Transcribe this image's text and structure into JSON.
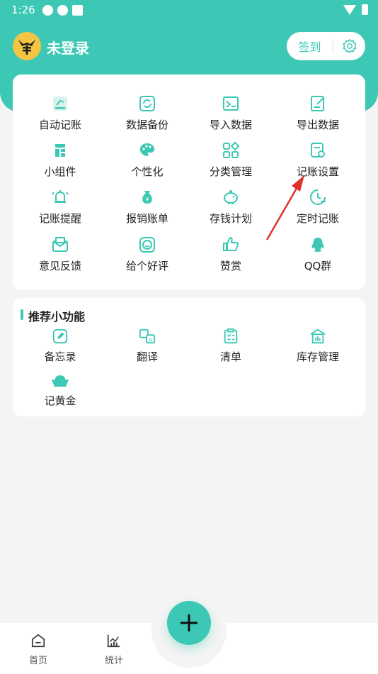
{
  "status_bar": {
    "time": "1:26"
  },
  "header": {
    "username": "未登录",
    "signin_label": "签到"
  },
  "tools": [
    {
      "label": "自动记账",
      "icon": "auto-bookkeeping-icon"
    },
    {
      "label": "数据备份",
      "icon": "data-backup-icon"
    },
    {
      "label": "导入数据",
      "icon": "import-data-icon"
    },
    {
      "label": "导出数据",
      "icon": "export-data-icon"
    },
    {
      "label": "小组件",
      "icon": "widget-icon"
    },
    {
      "label": "个性化",
      "icon": "palette-icon"
    },
    {
      "label": "分类管理",
      "icon": "category-icon"
    },
    {
      "label": "记账设置",
      "icon": "settings-doc-icon"
    },
    {
      "label": "记账提醒",
      "icon": "bell-icon"
    },
    {
      "label": "报销账单",
      "icon": "money-bag-icon"
    },
    {
      "label": "存钱计划",
      "icon": "piggy-bank-icon"
    },
    {
      "label": "定时记账",
      "icon": "clock-icon"
    },
    {
      "label": "意见反馈",
      "icon": "feedback-icon"
    },
    {
      "label": "给个好评",
      "icon": "rate-icon"
    },
    {
      "label": "赞赏",
      "icon": "thumbs-up-icon"
    },
    {
      "label": "QQ群",
      "icon": "qq-icon"
    }
  ],
  "recommended": {
    "title": "推荐小功能",
    "items": [
      {
        "label": "备忘录",
        "icon": "memo-icon"
      },
      {
        "label": "翻译",
        "icon": "translate-icon"
      },
      {
        "label": "清单",
        "icon": "checklist-icon"
      },
      {
        "label": "库存管理",
        "icon": "warehouse-icon"
      },
      {
        "label": "记黄金",
        "icon": "gold-icon"
      }
    ]
  },
  "bottom_nav": {
    "home_label": "首页",
    "stats_label": "统计"
  },
  "colors": {
    "accent": "#3cc8b4",
    "arrow": "#e0302a"
  }
}
